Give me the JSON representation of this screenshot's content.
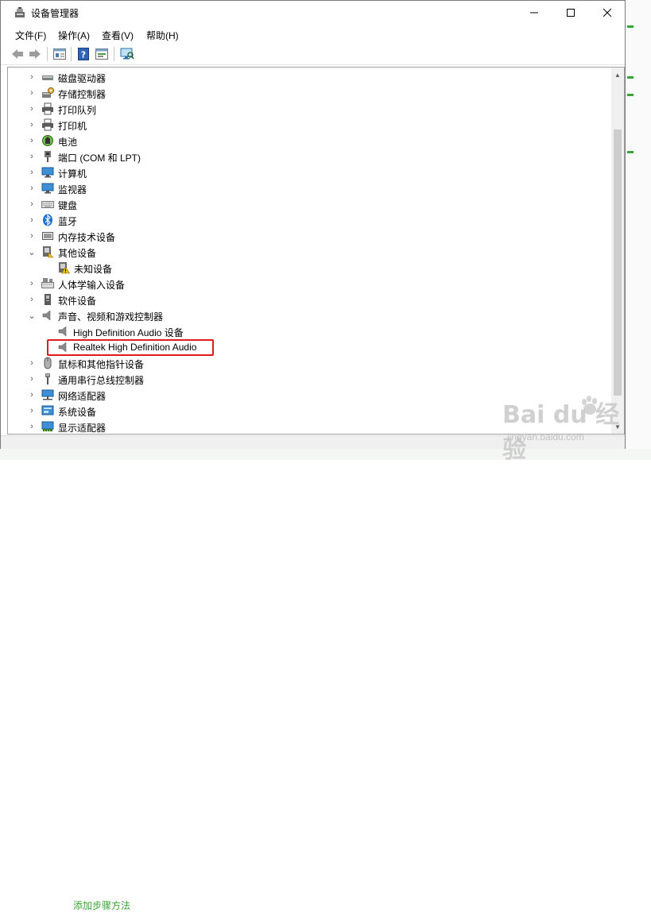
{
  "window": {
    "title": "设备管理器",
    "controls": {
      "minimize": "—",
      "maximize": "☐",
      "close": "✕"
    }
  },
  "menubar": {
    "items": [
      {
        "label": "文件(F)"
      },
      {
        "label": "操作(A)"
      },
      {
        "label": "查看(V)"
      },
      {
        "label": "帮助(H)"
      }
    ]
  },
  "toolbar": {
    "buttons": [
      "back-arrow-icon",
      "forward-arrow-icon",
      "properties-icon",
      "help-icon",
      "update-driver-icon",
      "scan-hardware-icon"
    ]
  },
  "tree": {
    "items": [
      {
        "label": "磁盘驱动器",
        "expanded": false,
        "icon": "disk-drive-icon"
      },
      {
        "label": "存储控制器",
        "expanded": false,
        "icon": "storage-controller-icon"
      },
      {
        "label": "打印队列",
        "expanded": false,
        "icon": "print-queue-icon"
      },
      {
        "label": "打印机",
        "expanded": false,
        "icon": "printer-icon"
      },
      {
        "label": "电池",
        "expanded": false,
        "icon": "battery-icon"
      },
      {
        "label": "端口 (COM 和 LPT)",
        "expanded": false,
        "icon": "port-icon"
      },
      {
        "label": "计算机",
        "expanded": false,
        "icon": "computer-icon"
      },
      {
        "label": "监视器",
        "expanded": false,
        "icon": "monitor-icon"
      },
      {
        "label": "键盘",
        "expanded": false,
        "icon": "keyboard-icon"
      },
      {
        "label": "蓝牙",
        "expanded": false,
        "icon": "bluetooth-icon"
      },
      {
        "label": "内存技术设备",
        "expanded": false,
        "icon": "memory-device-icon"
      },
      {
        "label": "其他设备",
        "expanded": true,
        "icon": "other-devices-icon"
      },
      {
        "label": "未知设备",
        "child": true,
        "icon": "unknown-device-warning-icon"
      },
      {
        "label": "人体学输入设备",
        "expanded": false,
        "icon": "hid-icon"
      },
      {
        "label": "软件设备",
        "expanded": false,
        "icon": "software-device-icon"
      },
      {
        "label": "声音、视频和游戏控制器",
        "expanded": true,
        "icon": "speaker-icon"
      },
      {
        "label": "High Definition Audio 设备",
        "child": true,
        "icon": "speaker-icon"
      },
      {
        "label": "Realtek High Definition Audio",
        "child": true,
        "icon": "speaker-icon",
        "highlighted": true
      },
      {
        "label": "鼠标和其他指针设备",
        "expanded": false,
        "icon": "mouse-icon"
      },
      {
        "label": "通用串行总线控制器",
        "expanded": false,
        "icon": "usb-icon"
      },
      {
        "label": "网络适配器",
        "expanded": false,
        "icon": "network-adapter-icon"
      },
      {
        "label": "系统设备",
        "expanded": false,
        "icon": "system-device-icon"
      },
      {
        "label": "显示适配器",
        "expanded": false,
        "icon": "display-adapter-icon"
      }
    ]
  },
  "watermark": {
    "logo": "Bai du 经验",
    "url": "jingyan.baidu.com"
  },
  "background": {
    "bottom_text": "添加步骤方法"
  },
  "colors": {
    "highlight": "#e11b1b",
    "watermark_green": "#3aa335"
  }
}
